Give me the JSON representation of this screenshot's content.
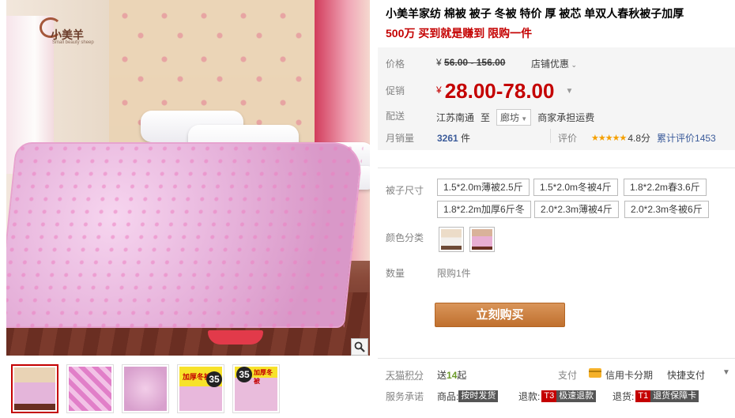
{
  "gallery": {
    "logo_text": "小美羊",
    "logo_sub": "Small beauty sheep",
    "zoom_icon": "magnifier-icon",
    "thumbs": [
      {
        "name": "thumb-1",
        "active": true
      },
      {
        "name": "thumb-2",
        "active": false
      },
      {
        "name": "thumb-3",
        "active": false
      },
      {
        "name": "thumb-4",
        "active": false,
        "tag": "加厚冬被",
        "num": "35"
      },
      {
        "name": "thumb-5",
        "active": false,
        "num": "35",
        "tag": "加厚冬被"
      }
    ]
  },
  "product": {
    "title": "小美羊家纺 棉被 被子 冬被 特价 厚 被芯 单双人春秋被子加厚",
    "subtitle": "500万 买到就是赚到 限购一件"
  },
  "price": {
    "label": "价格",
    "currency": "¥",
    "original": "56.00 - 156.00",
    "shop_discount": "店铺优惠",
    "promo_label": "促销",
    "promo_price": "28.00-78.00"
  },
  "shipping": {
    "label": "配送",
    "from": "江苏南通",
    "to_word": "至",
    "destination": "廊坊",
    "note": "商家承担运费"
  },
  "sales": {
    "label": "月销量",
    "count": "3261",
    "unit": "件",
    "rating_label": "评价",
    "stars": "★★★★★",
    "score": "4.8分",
    "review_text": "累计评价1453"
  },
  "sku": {
    "size_label": "被子尺寸",
    "sizes": [
      "1.5*2.0m薄被2.5斤",
      "1.5*2.0m冬被4斤",
      "1.8*2.2m春3.6斤",
      "1.8*2.2m加厚6斤冬",
      "2.0*2.3m薄被4斤",
      "2.0*2.3m冬被6斤"
    ],
    "color_label": "颜色分类",
    "quantity_label": "数量",
    "quantity_value": "限购1件",
    "buy_label": "立刻购买"
  },
  "footer": {
    "points_label": "天猫积分",
    "points_prefix": "送",
    "points_value": "14",
    "points_suffix": "起",
    "pay_label": "支付",
    "card_text": "信用卡分期",
    "fast_pay": "快捷支付",
    "service_label": "服务承诺",
    "svc1_label": "商品:",
    "svc1_tag": "按时发货",
    "svc2_label": "退款:",
    "svc2_code": "T3",
    "svc2_tag": "极速退款",
    "svc3_label": "退货:",
    "svc3_code": "T1",
    "svc3_tag": "退货保障卡"
  },
  "colors": {
    "price_red": "#c40000",
    "buy_button": "#c8803f",
    "link_blue": "#3b5b9a",
    "star": "#f5a000"
  }
}
